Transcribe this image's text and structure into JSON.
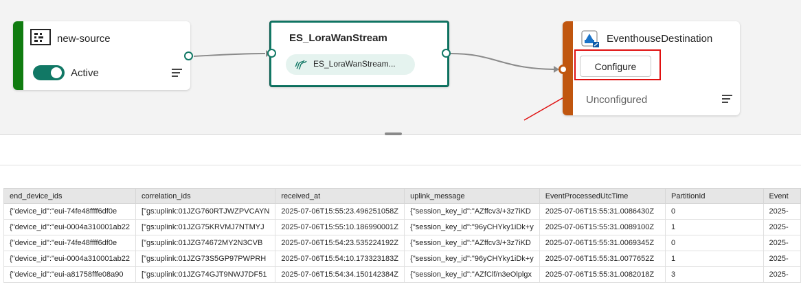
{
  "source": {
    "title": "new-source",
    "status_label": "Active",
    "stripe_color": "#107c10"
  },
  "stream": {
    "title": "ES_LoraWanStream",
    "chip_label": "ES_LoraWanStream...",
    "accent": "#117865"
  },
  "destination": {
    "title": "EventhouseDestination",
    "configure_label": "Configure",
    "status_label": "Unconfigured",
    "stripe_color": "#c0560f"
  },
  "annotation": {
    "highlight_color": "#e01010"
  },
  "table": {
    "columns": [
      "end_device_ids",
      "correlation_ids",
      "received_at",
      "uplink_message",
      "EventProcessedUtcTime",
      "PartitionId",
      "Event"
    ],
    "rows": [
      [
        "{\"device_id\":\"eui-74fe48ffff6df0e",
        "[\"gs:uplink:01JZG760RTJWZPVCAYN",
        "2025-07-06T15:55:23.496251058Z",
        "{\"session_key_id\":\"AZffcv3/+3z7iKD",
        "2025-07-06T15:55:31.0086430Z",
        "0",
        "2025-"
      ],
      [
        "{\"device_id\":\"eui-0004a310001ab22",
        "[\"gs:uplink:01JZG75KRVMJ7NTMYJ",
        "2025-07-06T15:55:10.186990001Z",
        "{\"session_key_id\":\"96yCHYky1iDk+y",
        "2025-07-06T15:55:31.0089100Z",
        "1",
        "2025-"
      ],
      [
        "{\"device_id\":\"eui-74fe48ffff6df0e",
        "[\"gs:uplink:01JZG74672MY2N3CVB",
        "2025-07-06T15:54:23.535224192Z",
        "{\"session_key_id\":\"AZffcv3/+3z7iKD",
        "2025-07-06T15:55:31.0069345Z",
        "0",
        "2025-"
      ],
      [
        "{\"device_id\":\"eui-0004a310001ab22",
        "[\"gs:uplink:01JZG73S5GP97PWPRH",
        "2025-07-06T15:54:10.173323183Z",
        "{\"session_key_id\":\"96yCHYky1iDk+y",
        "2025-07-06T15:55:31.0077652Z",
        "1",
        "2025-"
      ],
      [
        "{\"device_id\":\"eui-a81758fffe08a90",
        "[\"gs:uplink:01JZG74GJT9NWJ7DF51",
        "2025-07-06T15:54:34.150142384Z",
        "{\"session_key_id\":\"AZfClf/n3eOlplgx",
        "2025-07-06T15:55:31.0082018Z",
        "3",
        "2025-"
      ]
    ]
  }
}
